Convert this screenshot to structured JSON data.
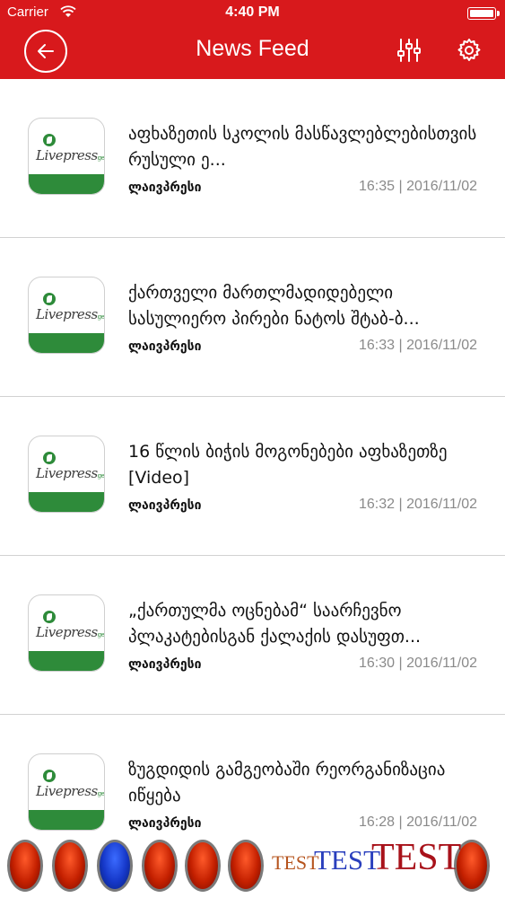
{
  "status_bar": {
    "carrier": "Carrier",
    "time": "4:40 PM"
  },
  "nav": {
    "title": "News Feed",
    "icons": [
      "back-arrow-icon",
      "sliders-icon",
      "gear-icon"
    ],
    "accent_color": "#d8191c"
  },
  "feed": {
    "items": [
      {
        "headline": "აფხაზეთის სკოლის მასწავლებლებისთვის რუსული ე...",
        "source": "ლაივპრესი",
        "time": "16:35",
        "date": "2016/11/02",
        "separator": "|",
        "thumbnail": "Livepress"
      },
      {
        "headline": "ქართველი მართლმადიდებელი სასულიერო პირები ნატოს შტაბ-ბ...",
        "source": "ლაივპრესი",
        "time": "16:33",
        "date": "2016/11/02",
        "separator": "|",
        "thumbnail": "Livepress"
      },
      {
        "headline": "16 წლის ბიჭის მოგონებები აფხაზეთზე [Video]",
        "source": "ლაივპრესი",
        "time": "16:32",
        "date": "2016/11/02",
        "separator": "|",
        "thumbnail": "Livepress"
      },
      {
        "headline": "„ქართულმა ოცნებამ“ საარჩევნო პლაკატებისგან ქალაქის დასუფთ...",
        "source": "ლაივპრესი",
        "time": "16:30",
        "date": "2016/11/02",
        "separator": "|",
        "thumbnail": "Livepress"
      },
      {
        "headline": "ზუგდიდის გამგეობაში რეორგანიზაცია იწყება",
        "source": "ლაივპრესი",
        "time": "16:28",
        "date": "2016/11/02",
        "separator": "|",
        "thumbnail": "Livepress"
      }
    ]
  },
  "bottom_bar": {
    "test_small": "TEST",
    "test_medium": "TEST",
    "test_large": "TEST",
    "orb_colors": [
      "red",
      "red",
      "blue",
      "red",
      "red",
      "red",
      "red"
    ]
  }
}
